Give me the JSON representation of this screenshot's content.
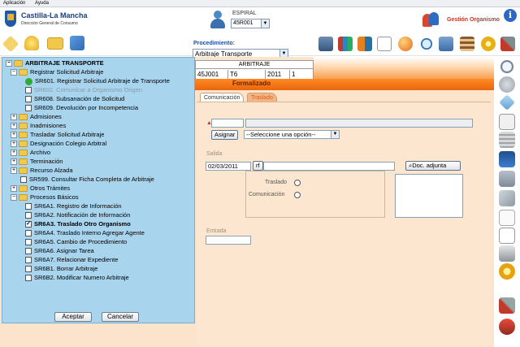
{
  "menubar": {
    "items": [
      "Aplicación",
      "Ayuda"
    ]
  },
  "header": {
    "brand": "Castilla-La Mancha",
    "brand_sub": "Dirección General de Consumo",
    "espiral_label": "ESPIRAL",
    "espiral_value": "45R001",
    "gestion_label": "Gestión Organismo",
    "procedimiento_label": "Procedimiento:",
    "procedimiento_value": "Arbitraje Transporte"
  },
  "tree": {
    "root": "ARBITRAJE TRANSPORTE",
    "rows": [
      {
        "label": "Registrar Solicitud Arbitraje"
      },
      {
        "label": "SR601. Registrar Solicitud Arbitraje de Transporte"
      },
      {
        "label": "SR602. Comunicar a Organismo Origen"
      },
      {
        "label": "SR608. Subsanación de Solicitud"
      },
      {
        "label": "SR609. Devolución por Incompetencia"
      },
      {
        "label": "Admisiones"
      },
      {
        "label": "Inadmisiones"
      },
      {
        "label": "Trasladar Solicitud Arbitraje"
      },
      {
        "label": "Designación Colegio Arbitral"
      },
      {
        "label": "Archivo"
      },
      {
        "label": "Terminación"
      },
      {
        "label": "Recurso Alzada"
      },
      {
        "label": "SR599. Consultar Ficha Completa de Arbitraje"
      },
      {
        "label": "Otros Trámites"
      },
      {
        "label": "Procesos Básicos"
      },
      {
        "label": "SR6A1. Registro de Información"
      },
      {
        "label": "SR6A2. Notificación de Información"
      },
      {
        "label": "SR6A3. Traslado Otro Organismo"
      },
      {
        "label": "SR6A4. Traslado Interno Agregar Agente"
      },
      {
        "label": "SR6A5. Cambio de Procedimiento"
      },
      {
        "label": "SR6A6. Asignar Tarea"
      },
      {
        "label": "SR6A7. Relacionar Expediente"
      },
      {
        "label": "SR6B1. Borrar Arbitraje"
      },
      {
        "label": "SR6B2. Modificar Numero Arbitraje"
      }
    ],
    "accept_label": "Aceptar",
    "cancel_label": "Cancelar"
  },
  "arbitraje": {
    "title": "ARBITRAJE",
    "cells": [
      "45J001",
      "T6",
      "2011",
      "1"
    ],
    "status": "Formalizado"
  },
  "tabs": [
    "Comunicación",
    "Traslado"
  ],
  "form": {
    "assign_button": "Asignar",
    "select_placeholder": "--Seleccione una opción--",
    "salida_label": "Salida",
    "salida_date": "02/03/2011",
    "rf_button": "rf",
    "doc_button": "Doc. adjunta",
    "traslado_label": "Traslado",
    "comunicacion_label": "Comunicación",
    "entrada_label": "Entrada"
  },
  "colors": {
    "accent_orange": "#f07a1a",
    "tree_bg": "#a9d4ee",
    "content_bg": "#fde6cf"
  }
}
